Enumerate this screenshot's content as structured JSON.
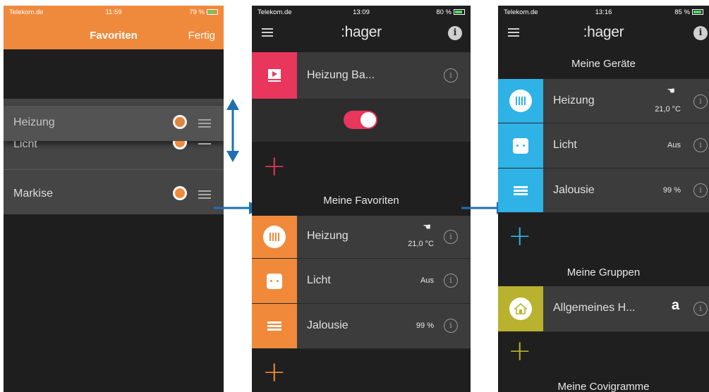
{
  "screen1": {
    "status": {
      "carrier": "Telekom.de",
      "time": "11:59",
      "battery": "79 %"
    },
    "title": "Favoriten",
    "done": "Fertig",
    "items": [
      {
        "label": "Heizung"
      },
      {
        "label": "Licht"
      },
      {
        "label": "Markise"
      }
    ]
  },
  "screen2": {
    "status": {
      "carrier": "Telekom.de",
      "time": "13:09",
      "battery": "80 %"
    },
    "logo": ":hager",
    "info": "i",
    "room": {
      "label": "Heizung Ba..."
    },
    "section_favorites": "Meine Favoriten",
    "favorites": [
      {
        "label": "Heizung",
        "value": "21,0 °C"
      },
      {
        "label": "Licht",
        "value": "Aus"
      },
      {
        "label": "Jalousie",
        "value": "99 %"
      }
    ],
    "colors": {
      "accent_pink": "#e8365d",
      "accent_orange": "#f08a3a"
    }
  },
  "screen3": {
    "status": {
      "carrier": "Telekom.de",
      "time": "13:16",
      "battery": "85 %"
    },
    "logo": ":hager",
    "info": "i",
    "section_devices": "Meine Geräte",
    "devices": [
      {
        "label": "Heizung",
        "value": "21,0 °C"
      },
      {
        "label": "Licht",
        "value": "Aus"
      },
      {
        "label": "Jalousie",
        "value": "99 %"
      }
    ],
    "section_groups": "Meine Gruppen",
    "groups": [
      {
        "label": "Allgemeines H...",
        "value": "a"
      }
    ],
    "section_scenes": "Meine Covigramme",
    "colors": {
      "accent_blue": "#2fb2e6",
      "accent_olive": "#b9b22e"
    }
  },
  "arrows": {
    "color": "#1f6fb2"
  }
}
